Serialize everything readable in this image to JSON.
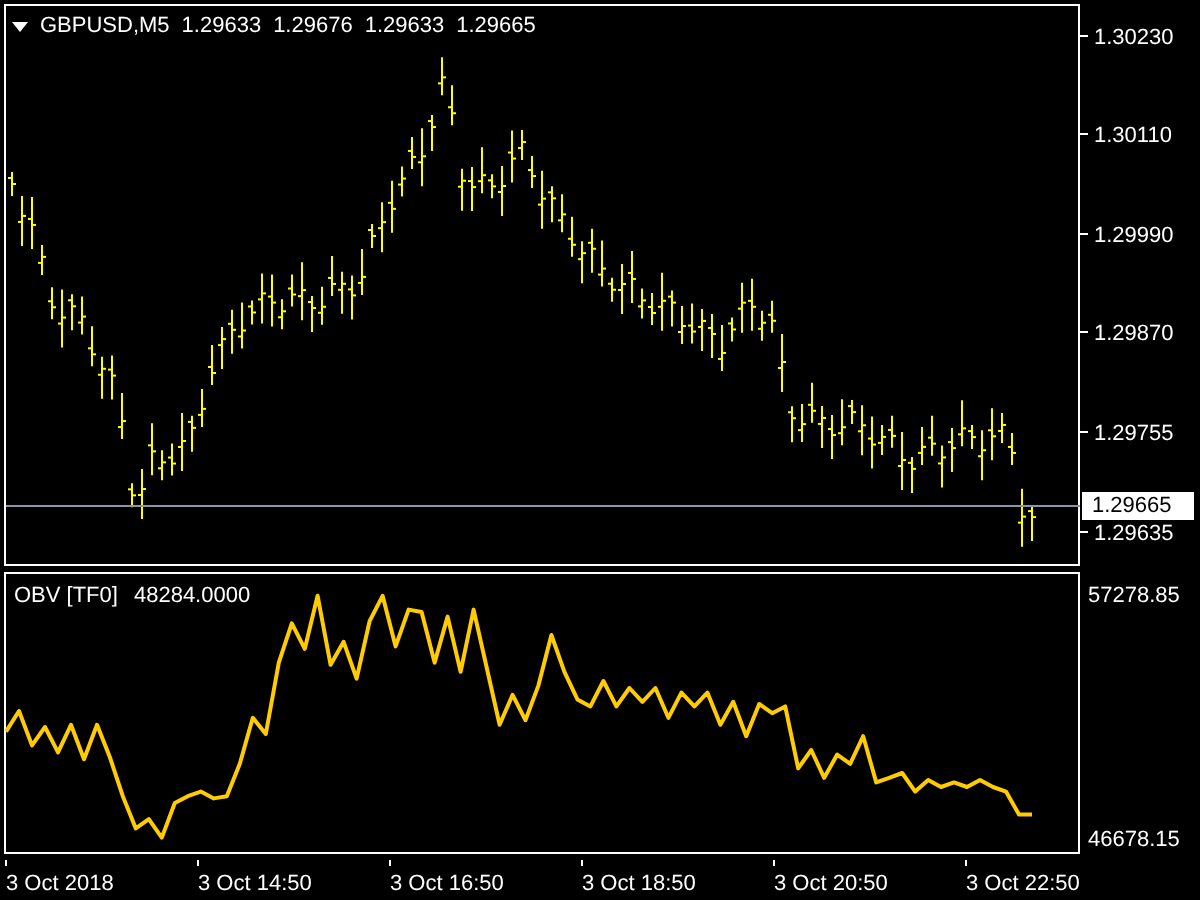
{
  "price_chart": {
    "symbol": "GBPUSD,M5",
    "ohlc": [
      "1.29633",
      "1.29676",
      "1.29633",
      "1.29665"
    ],
    "price_ticks": [
      "1.30230",
      "1.30110",
      "1.29990",
      "1.29870",
      "1.29755",
      "1.29635"
    ],
    "current_price": "1.29665"
  },
  "obv_panel": {
    "name": "OBV [TF0]",
    "reading": "48284.0000",
    "chart_data": {
      "type": "line",
      "yticks": [
        46678.15,
        57278.85
      ],
      "ylim": [
        46030,
        58190
      ],
      "series": [
        {
          "color": "#ffcc00",
          "values": [
            51300,
            52200,
            50700,
            51500,
            50400,
            51600,
            50100,
            51600,
            50200,
            48500,
            47100,
            47500,
            46700,
            48200,
            48500,
            48700,
            48400,
            48500,
            49900,
            51900,
            51200,
            54300,
            56000,
            54900,
            57200,
            54200,
            55200,
            53600,
            56100,
            57200,
            55000,
            56600,
            56500,
            54300,
            56300,
            53900,
            56600,
            54100,
            51600,
            52900,
            51800,
            53300,
            55500,
            53900,
            52700,
            52400,
            53500,
            52400,
            53200,
            52600,
            53200,
            51900,
            53000,
            52400,
            53000,
            51600,
            52600,
            51100,
            52500,
            52100,
            52400,
            49700,
            50500,
            49300,
            50300,
            49900,
            51100,
            49100,
            49300,
            49500,
            48700,
            49200,
            48900,
            49100,
            48900,
            49200,
            48900,
            48700,
            47700,
            47700
          ]
        }
      ]
    }
  },
  "time_axis": [
    "3 Oct 2018",
    "3 Oct 14:50",
    "3 Oct 16:50",
    "3 Oct 18:50",
    "3 Oct 20:50",
    "3 Oct 22:50"
  ]
}
